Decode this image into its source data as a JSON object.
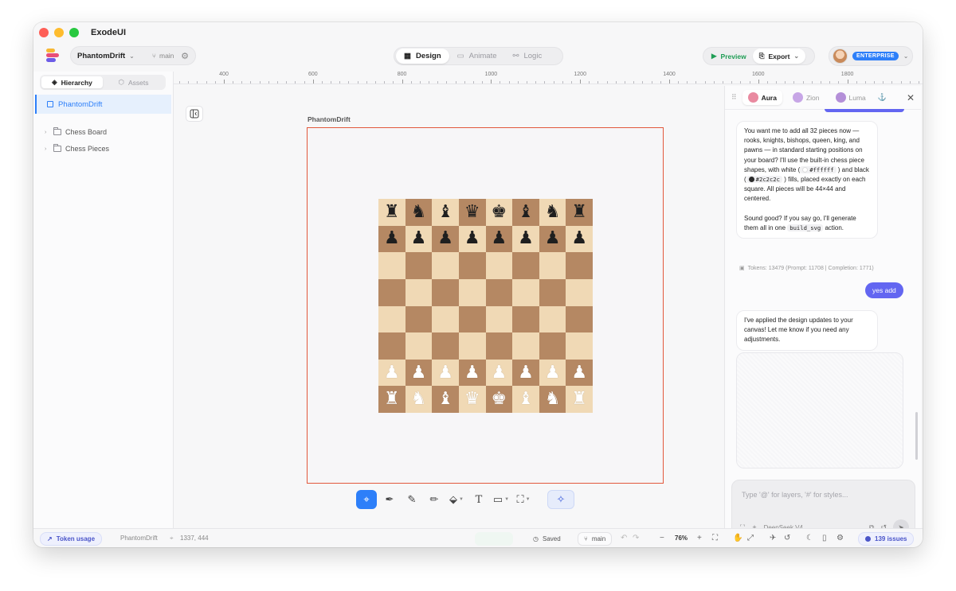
{
  "app": {
    "title": "ExodeUI"
  },
  "toolbar": {
    "project_name": "PhantomDrift",
    "branch": "main",
    "modes": [
      {
        "label": "Design",
        "active": true
      },
      {
        "label": "Animate",
        "active": false
      },
      {
        "label": "Logic",
        "active": false
      }
    ],
    "preview_label": "Preview",
    "export_label": "Export",
    "plan_badge": "ENTERPRISE"
  },
  "left_panel": {
    "tabs": [
      {
        "label": "Hierarchy",
        "active": true
      },
      {
        "label": "Assets",
        "active": false
      }
    ],
    "root": "PhantomDrift",
    "items": [
      "Chess Board",
      "Chess Pieces"
    ]
  },
  "ruler": {
    "labels": [
      "400",
      "600",
      "800",
      "1000",
      "1200",
      "1400",
      "1600",
      "1800"
    ]
  },
  "canvas": {
    "frame_label": "PhantomDrift",
    "board": {
      "rows": [
        [
          "♜",
          "♞",
          "♝",
          "♛",
          "♚",
          "♝",
          "♞",
          "♜"
        ],
        [
          "♟",
          "♟",
          "♟",
          "♟",
          "♟",
          "♟",
          "♟",
          "♟"
        ],
        [
          "",
          "",
          "",
          "",
          "",
          "",
          "",
          ""
        ],
        [
          "",
          "",
          "",
          "",
          "",
          "",
          "",
          ""
        ],
        [
          "",
          "",
          "",
          "",
          "",
          "",
          "",
          ""
        ],
        [
          "",
          "",
          "",
          "",
          "",
          "",
          "",
          ""
        ],
        [
          "♟",
          "♟",
          "♟",
          "♟",
          "♟",
          "♟",
          "♟",
          "♟"
        ],
        [
          "♜",
          "♞",
          "♝",
          "♛",
          "♚",
          "♝",
          "♞",
          "♜"
        ]
      ],
      "piece_colors": [
        "black",
        "black",
        "",
        "",
        "",
        "",
        "white",
        "white"
      ],
      "light_color": "#f0d9b5",
      "dark_color": "#b58863"
    }
  },
  "chat": {
    "agents": [
      {
        "name": "Aura",
        "active": true,
        "color": "#e98aa0"
      },
      {
        "name": "Zion",
        "active": false,
        "color": "#c7a6e6"
      },
      {
        "name": "Luma",
        "active": false,
        "color": "#b48fd8"
      }
    ],
    "msg1": {
      "p1": "You want me to add all 32 pieces now — rooks, knights, bishops, queen, king, and pawns — in standard starting positions on your board? I'll use the built-in chess piece shapes, with white (",
      "white_hex": "#ffffff",
      "p2": ") and black (",
      "black_hex": "#2c2c2c",
      "p3": ") fills, placed exactly on each square. All pieces will be 44×44 and centered.",
      "p4": "Sound good? If you say go, I'll generate them all in one",
      "code": "build_svg",
      "p5": "action."
    },
    "tokens": "Tokens: 13479 (Prompt: 11708 | Completion: 1771)",
    "user_msg": "yes add",
    "msg2": "I've applied the design updates to your canvas! Let me know if you need any adjustments.",
    "input_placeholder": "Type '@' for layers, '#' for styles...",
    "model": "DeepSeek V4 ..."
  },
  "status": {
    "token_usage": "Token usage",
    "project": "PhantomDrift",
    "coords": "1337, 444",
    "saved": "Saved",
    "branch": "main",
    "zoom": "76%",
    "issues": "139 issues"
  }
}
